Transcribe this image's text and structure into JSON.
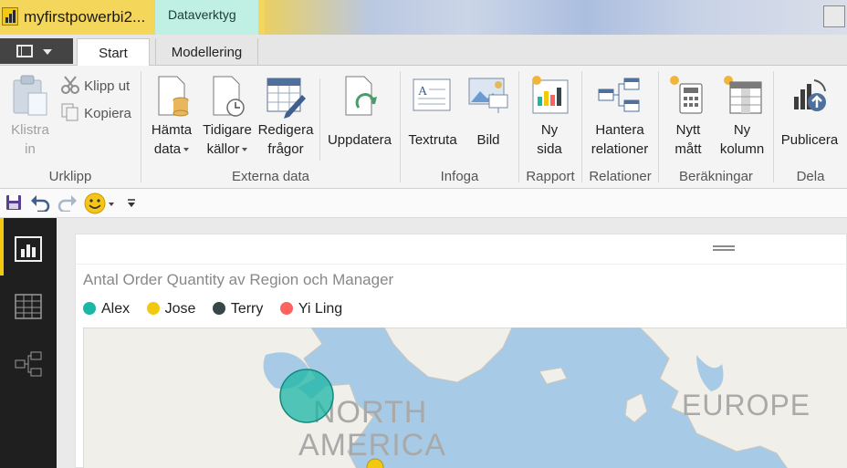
{
  "window": {
    "title": "myfirstpowerbi2...",
    "context_tab": "Dataverktyg"
  },
  "tabs": [
    {
      "label": "Start",
      "active": true
    },
    {
      "label": "Modellering",
      "active": false
    }
  ],
  "ribbon": {
    "urklipp": {
      "group_label": "Urklipp",
      "paste_line1": "Klistra",
      "paste_line2": "in",
      "cut": "Klipp ut",
      "copy": "Kopiera"
    },
    "externa": {
      "group_label": "Externa data",
      "get_line1": "Hämta",
      "get_line2": "data",
      "recent_line1": "Tidigare",
      "recent_line2": "källor",
      "edit_line1": "Redigera",
      "edit_line2": "frågor",
      "refresh": "Uppdatera"
    },
    "infoga": {
      "group_label": "Infoga",
      "textbox": "Textruta",
      "image": "Bild"
    },
    "rapport": {
      "group_label": "Rapport",
      "new_page_line1": "Ny",
      "new_page_line2": "sida"
    },
    "relationer": {
      "group_label": "Relationer",
      "manage_line1": "Hantera",
      "manage_line2": "relationer"
    },
    "berakningar": {
      "group_label": "Beräkningar",
      "measure_line1": "Nytt",
      "measure_line2": "mått",
      "column_line1": "Ny",
      "column_line2": "kolumn"
    },
    "dela": {
      "group_label": "Dela",
      "publish": "Publicera"
    }
  },
  "report": {
    "chart_title": "Antal Order Quantity av Region och Manager",
    "legend": [
      {
        "name": "Alex",
        "color": "#1ab7a6"
      },
      {
        "name": "Jose",
        "color": "#f2c811"
      },
      {
        "name": "Terry",
        "color": "#374649"
      },
      {
        "name": "Yi Ling",
        "color": "#fd625e"
      }
    ],
    "map_labels": {
      "na_line1": "NORTH",
      "na_line2": "AMERICA",
      "europe": "EUROPE"
    },
    "bubbles": [
      {
        "manager": "Alex",
        "color": "#1ab7a6"
      },
      {
        "manager": "Jose",
        "color": "#f2c811"
      }
    ]
  },
  "colors": {
    "powerbi_yellow": "#f2c811",
    "nav_dark": "#1f1f1f",
    "ribbon_bg": "#f4f4f4"
  }
}
